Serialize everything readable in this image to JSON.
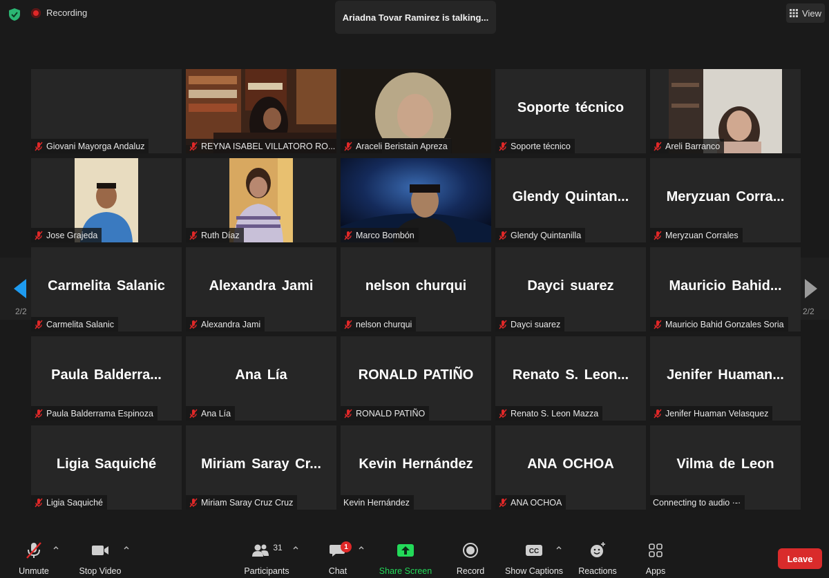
{
  "topbar": {
    "recording_label": "Recording",
    "talking_banner": "Ariadna Tovar Ramirez is talking...",
    "view_label": "View"
  },
  "pagination": {
    "left": "2/2",
    "right": "2/2"
  },
  "tiles": [
    {
      "display": "",
      "label": "Giovani Mayorga Andaluz",
      "muted": true
    },
    {
      "display": "",
      "label": "REYNA ISABEL VILLATORO RO...",
      "muted": true
    },
    {
      "display": "",
      "label": "Araceli Beristain Apreza",
      "muted": true
    },
    {
      "display": "Soporte técnico",
      "label": "Soporte técnico",
      "muted": true
    },
    {
      "display": "",
      "label": "Areli Barranco",
      "muted": true
    },
    {
      "display": "",
      "label": "Jose Grajeda",
      "muted": true
    },
    {
      "display": "",
      "label": "Ruth Díaz",
      "muted": true
    },
    {
      "display": "",
      "label": "Marco Bombón",
      "muted": true
    },
    {
      "display": "Glendy  Quintan...",
      "label": "Glendy Quintanilla",
      "muted": true
    },
    {
      "display": "Meryzuan  Corra...",
      "label": "Meryzuan Corrales",
      "muted": true
    },
    {
      "display": "Carmelita Salanic",
      "label": "Carmelita Salanic",
      "muted": true
    },
    {
      "display": "Alexandra Jami",
      "label": "Alexandra Jami",
      "muted": true
    },
    {
      "display": "nelson churqui",
      "label": "nelson churqui",
      "muted": true
    },
    {
      "display": "Dayci suarez",
      "label": "Dayci suarez",
      "muted": true
    },
    {
      "display": "Mauricio  Bahid...",
      "label": "Mauricio Bahid Gonzales Soria",
      "muted": true
    },
    {
      "display": "Paula  Balderra...",
      "label": "Paula Balderrama Espinoza",
      "muted": true
    },
    {
      "display": "Ana Lía",
      "label": "Ana Lía",
      "muted": true
    },
    {
      "display": "RONALD PATIÑO",
      "label": "RONALD PATIÑO",
      "muted": true
    },
    {
      "display": "Renato S. Leon...",
      "label": "Renato S. Leon Mazza",
      "muted": true
    },
    {
      "display": "Jenifer  Huaman...",
      "label": "Jenifer Huaman Velasquez",
      "muted": true
    },
    {
      "display": "Ligia Saquiché",
      "label": "Ligia Saquiché",
      "muted": true
    },
    {
      "display": "Miriam  Saray  Cr...",
      "label": "Miriam Saray Cruz Cruz",
      "muted": true
    },
    {
      "display": "Kevin Hernández",
      "label": "Kevin Hernández",
      "muted": false
    },
    {
      "display": "ANA OCHOA",
      "label": "ANA OCHOA",
      "muted": true
    },
    {
      "display": "Vilma de Leon",
      "label": "Connecting to audio ·-·",
      "muted": false
    }
  ],
  "toolbar": {
    "unmute": "Unmute",
    "stop_video": "Stop Video",
    "participants": "Participants",
    "participants_count": "31",
    "chat": "Chat",
    "chat_badge": "1",
    "share_screen": "Share Screen",
    "record": "Record",
    "show_captions": "Show Captions",
    "reactions": "Reactions",
    "apps": "Apps",
    "leave": "Leave"
  },
  "colors": {
    "background": "#1a1a1a",
    "tile": "#262626",
    "muted_red": "#e02828",
    "share_green": "#23d959",
    "leave_red": "#d92b2b",
    "shield_green": "#2bb673"
  },
  "icons": [
    "shield-icon",
    "record-dot-icon",
    "grid-icon",
    "mic-muted-icon",
    "video-icon",
    "participants-icon",
    "chat-icon",
    "share-arrow-icon",
    "record-icon",
    "cc-icon",
    "reaction-icon",
    "apps-icon",
    "chevron-up-icon",
    "arrow-left-icon",
    "arrow-right-icon"
  ]
}
